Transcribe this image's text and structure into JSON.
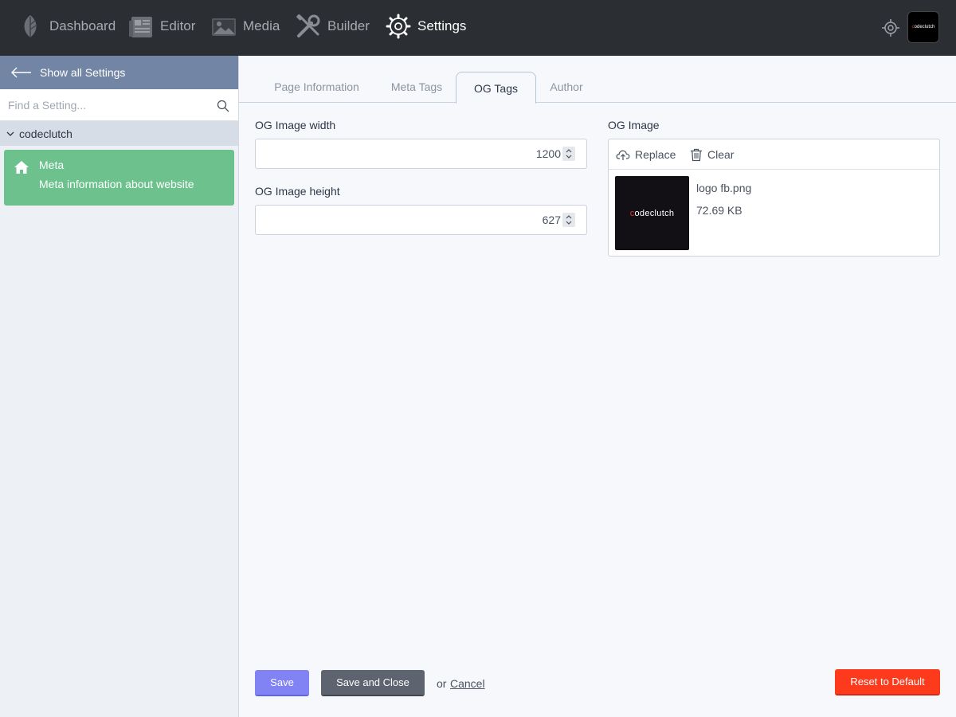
{
  "nav": {
    "items": [
      {
        "label": "Dashboard",
        "icon": "leaf-icon"
      },
      {
        "label": "Editor",
        "icon": "newspaper-icon"
      },
      {
        "label": "Media",
        "icon": "image-icon"
      },
      {
        "label": "Builder",
        "icon": "tools-icon"
      },
      {
        "label": "Settings",
        "icon": "gear-icon",
        "active": true
      }
    ],
    "logo_text_prefix": "c",
    "logo_text_rest": "odeclutch"
  },
  "sidebar": {
    "back_label": "Show all Settings",
    "search_placeholder": "Find a Setting...",
    "group_label": "codeclutch",
    "card": {
      "title": "Meta",
      "description": "Meta information about website"
    }
  },
  "tabs": [
    {
      "label": "Page Information"
    },
    {
      "label": "Meta Tags"
    },
    {
      "label": "OG Tags",
      "active": true
    },
    {
      "label": "Author"
    }
  ],
  "form": {
    "width_label": "OG Image width",
    "width_value": "1200",
    "height_label": "OG Image height",
    "height_value": "627",
    "image_label": "OG Image",
    "replace_label": "Replace",
    "clear_label": "Clear",
    "file_name": "logo fb.png",
    "file_size": "72.69 KB",
    "thumb_prefix": "c",
    "thumb_rest": "odeclutch"
  },
  "footer": {
    "save_label": "Save",
    "save_close_label": "Save and Close",
    "or_text": "or",
    "cancel_label": "Cancel",
    "reset_label": "Reset to Default"
  },
  "colors": {
    "topbar": "#2b2e32",
    "sidebar_header": "#7385a4",
    "meta_card": "#6cc18c",
    "save": "#8183f4",
    "save_close": "#5d6470",
    "reset": "#fe3a1c"
  }
}
